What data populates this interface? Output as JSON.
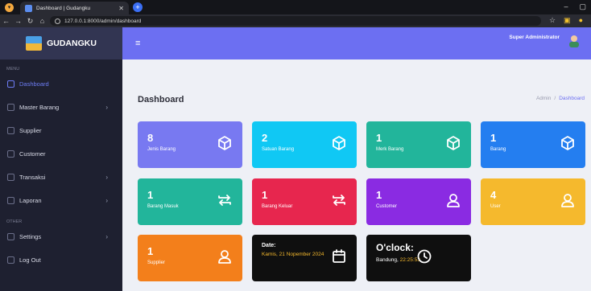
{
  "browser": {
    "tab_title": "Dashboard | Gudangku",
    "url": "127.0.0.1:8000/admin/dashboard"
  },
  "app": {
    "brand": "GUDANGKU",
    "header_user": "Super Administrator"
  },
  "sidebar": {
    "section_menu": "MENU",
    "section_other": "OTHER",
    "items": [
      {
        "label": "Dashboard",
        "icon": "home-icon"
      },
      {
        "label": "Master Barang",
        "icon": "cube-icon"
      },
      {
        "label": "Supplier",
        "icon": "user-icon"
      },
      {
        "label": "Customer",
        "icon": "user-icon"
      },
      {
        "label": "Transaksi",
        "icon": "swap-icon"
      },
      {
        "label": "Laporan",
        "icon": "report-icon"
      }
    ],
    "other_items": [
      {
        "label": "Settings",
        "icon": "gear-icon"
      },
      {
        "label": "Log Out",
        "icon": "logout-icon"
      }
    ]
  },
  "page": {
    "title": "Dashboard",
    "breadcrumb": [
      "Admin",
      "/",
      "Dashboard"
    ]
  },
  "cards": [
    {
      "value": "8",
      "label": "Jenis Barang",
      "color": "#7879f1",
      "icon": "cube-icon"
    },
    {
      "value": "2",
      "label": "Satuan Barang",
      "color": "#10c8f4",
      "icon": "cube-icon"
    },
    {
      "value": "1",
      "label": "Merk Barang",
      "color": "#22b59b",
      "icon": "cube-icon"
    },
    {
      "value": "1",
      "label": "Barang",
      "color": "#247ef0",
      "icon": "cube-icon"
    },
    {
      "value": "1",
      "label": "Barang Masuk",
      "color": "#22b59b",
      "icon": "swap-icon"
    },
    {
      "value": "1",
      "label": "Barang Keluar",
      "color": "#e7264e",
      "icon": "swap-icon"
    },
    {
      "value": "1",
      "label": "Customer",
      "color": "#8a2be2",
      "icon": "user-icon"
    },
    {
      "value": "4",
      "label": "User",
      "color": "#f5b92d",
      "icon": "user-icon"
    },
    {
      "value": "1",
      "label": "Supplier",
      "color": "#f37f1b",
      "icon": "user-icon"
    }
  ],
  "date_card": {
    "label": "Date:",
    "value": "Kamis, 21 Nopember 2024"
  },
  "clock_card": {
    "label": "O'clock:",
    "place": "Bandung, ",
    "time": "22:25:53"
  }
}
